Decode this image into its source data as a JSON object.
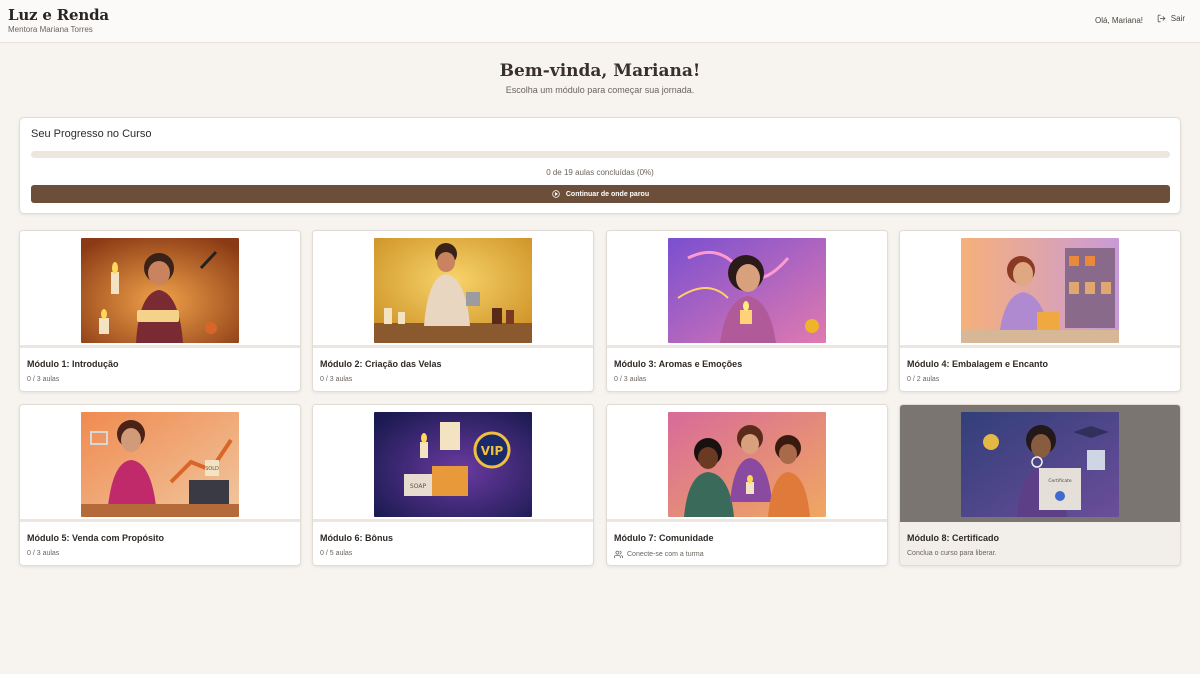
{
  "header": {
    "brand_title": "Luz e Renda",
    "brand_subtitle": "Mentora Mariana Torres",
    "greeting": "Olá, Mariana!",
    "logout_label": "Sair"
  },
  "welcome": {
    "title": "Bem-vinda, Mariana!",
    "subtitle": "Escolha um módulo para começar sua jornada."
  },
  "progress": {
    "title": "Seu Progresso no Curso",
    "completed": 0,
    "total": 19,
    "percent": 0,
    "status_text": "0 de 19 aulas concluídas (0%)",
    "continue_label": "Continuar de onde parou"
  },
  "modules": [
    {
      "title": "Módulo 1: Introdução",
      "meta": "0 / 3 aulas"
    },
    {
      "title": "Módulo 2: Criação das Velas",
      "meta": "0 / 3 aulas"
    },
    {
      "title": "Módulo 3: Aromas e Emoções",
      "meta": "0 / 3 aulas"
    },
    {
      "title": "Módulo 4: Embalagem e Encanto",
      "meta": "0 / 2 aulas"
    },
    {
      "title": "Módulo 5: Venda com Propósito",
      "meta": "0 / 3 aulas"
    },
    {
      "title": "Módulo 6: Bônus",
      "meta": "0 / 5 aulas"
    },
    {
      "title": "Módulo 7: Comunidade",
      "meta": "Conecte-se com a turma",
      "meta_icon": "users-icon"
    },
    {
      "title": "Módulo 8: Certificado",
      "meta": "Conclua o curso para liberar.",
      "locked": true
    }
  ],
  "art_labels": {
    "soap": "SOAP",
    "vip": "VIP",
    "sold": "SOLD",
    "certificate": "Certificate"
  },
  "colors": {
    "accent": "#6b4f3a",
    "page_bg": "#f7f4ef",
    "track": "#ece6df"
  }
}
